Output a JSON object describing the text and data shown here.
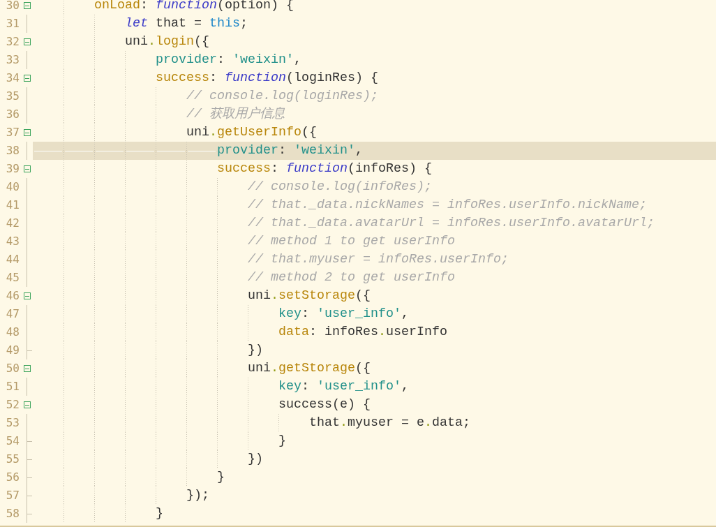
{
  "editor": {
    "lines": [
      {
        "number": "30",
        "kind": "code",
        "current": false,
        "tokens": [
          {
            "text": "onLoad",
            "kind": "method"
          },
          {
            "text": ": ",
            "kind": "plain"
          },
          {
            "text": "function",
            "kind": "keyword"
          },
          {
            "text": "(option) {",
            "kind": "plain"
          }
        ],
        "children": [
          {
            "number": "31",
            "kind": "code",
            "current": false,
            "tokens": [
              {
                "text": "let",
                "kind": "keyword"
              },
              {
                "text": " that = ",
                "kind": "plain"
              },
              {
                "text": "this",
                "kind": "this"
              },
              {
                "text": ";",
                "kind": "plain"
              }
            ]
          },
          {
            "number": "32",
            "kind": "code",
            "current": false,
            "tokens": [
              {
                "text": "uni",
                "kind": "plain"
              },
              {
                "text": ".",
                "kind": "dot"
              },
              {
                "text": "login",
                "kind": "method"
              },
              {
                "text": "({",
                "kind": "plain"
              }
            ],
            "children": [
              {
                "number": "33",
                "kind": "code",
                "current": false,
                "tokens": [
                  {
                    "text": "provider",
                    "kind": "prop"
                  },
                  {
                    "text": ": ",
                    "kind": "plain"
                  },
                  {
                    "text": "'weixin'",
                    "kind": "string"
                  },
                  {
                    "text": ",",
                    "kind": "plain"
                  }
                ]
              },
              {
                "number": "34",
                "kind": "code",
                "current": false,
                "tokens": [
                  {
                    "text": "success",
                    "kind": "method"
                  },
                  {
                    "text": ": ",
                    "kind": "plain"
                  },
                  {
                    "text": "function",
                    "kind": "keyword"
                  },
                  {
                    "text": "(loginRes) {",
                    "kind": "plain"
                  }
                ],
                "children": [
                  {
                    "number": "35",
                    "kind": "code",
                    "current": false,
                    "tokens": [
                      {
                        "text": "// console.log(loginRes);",
                        "kind": "comment"
                      }
                    ]
                  },
                  {
                    "number": "36",
                    "kind": "code",
                    "current": false,
                    "tokens": [
                      {
                        "text": "// 获取用户信息",
                        "kind": "comment"
                      }
                    ]
                  },
                  {
                    "number": "37",
                    "kind": "code",
                    "current": false,
                    "tokens": [
                      {
                        "text": "uni",
                        "kind": "plain"
                      },
                      {
                        "text": ".",
                        "kind": "dot"
                      },
                      {
                        "text": "getUserInfo",
                        "kind": "method"
                      },
                      {
                        "text": "({",
                        "kind": "plain"
                      }
                    ],
                    "children": [
                      {
                        "number": "38",
                        "kind": "code",
                        "current": true,
                        "tokens": [
                          {
                            "text": "provider",
                            "kind": "prop"
                          },
                          {
                            "text": ": ",
                            "kind": "plain"
                          },
                          {
                            "text": "'weixin'",
                            "kind": "string"
                          },
                          {
                            "text": ",",
                            "kind": "plain"
                          }
                        ]
                      },
                      {
                        "number": "39",
                        "kind": "code",
                        "current": false,
                        "tokens": [
                          {
                            "text": "success",
                            "kind": "method"
                          },
                          {
                            "text": ": ",
                            "kind": "plain"
                          },
                          {
                            "text": "function",
                            "kind": "keyword"
                          },
                          {
                            "text": "(infoRes) {",
                            "kind": "plain"
                          }
                        ],
                        "children": [
                          {
                            "number": "40",
                            "kind": "code",
                            "current": false,
                            "tokens": [
                              {
                                "text": "// console.log(infoRes);",
                                "kind": "comment"
                              }
                            ]
                          },
                          {
                            "number": "41",
                            "kind": "code",
                            "current": false,
                            "tokens": [
                              {
                                "text": "// that._data.nickNames = infoRes.userInfo.nickName;",
                                "kind": "comment"
                              }
                            ]
                          },
                          {
                            "number": "42",
                            "kind": "code",
                            "current": false,
                            "tokens": [
                              {
                                "text": "// that._data.avatarUrl = infoRes.userInfo.avatarUrl;",
                                "kind": "comment"
                              }
                            ]
                          },
                          {
                            "number": "43",
                            "kind": "code",
                            "current": false,
                            "tokens": [
                              {
                                "text": "// method 1 to get userInfo",
                                "kind": "comment"
                              }
                            ]
                          },
                          {
                            "number": "44",
                            "kind": "code",
                            "current": false,
                            "tokens": [
                              {
                                "text": "// that.myuser = infoRes.userInfo;",
                                "kind": "comment"
                              }
                            ]
                          },
                          {
                            "number": "45",
                            "kind": "code",
                            "current": false,
                            "tokens": [
                              {
                                "text": "// method 2 to get userInfo",
                                "kind": "comment"
                              }
                            ]
                          },
                          {
                            "number": "46",
                            "kind": "code",
                            "current": false,
                            "tokens": [
                              {
                                "text": "uni",
                                "kind": "plain"
                              },
                              {
                                "text": ".",
                                "kind": "dot"
                              },
                              {
                                "text": "setStorage",
                                "kind": "method"
                              },
                              {
                                "text": "({",
                                "kind": "plain"
                              }
                            ],
                            "children": [
                              {
                                "number": "47",
                                "kind": "code",
                                "current": false,
                                "tokens": [
                                  {
                                    "text": "key",
                                    "kind": "prop"
                                  },
                                  {
                                    "text": ": ",
                                    "kind": "plain"
                                  },
                                  {
                                    "text": "'user_info'",
                                    "kind": "string"
                                  },
                                  {
                                    "text": ",",
                                    "kind": "plain"
                                  }
                                ]
                              },
                              {
                                "number": "48",
                                "kind": "code",
                                "current": false,
                                "tokens": [
                                  {
                                    "text": "data",
                                    "kind": "method"
                                  },
                                  {
                                    "text": ": infoRes",
                                    "kind": "plain"
                                  },
                                  {
                                    "text": ".",
                                    "kind": "dot"
                                  },
                                  {
                                    "text": "userInfo",
                                    "kind": "plain"
                                  }
                                ]
                              }
                            ]
                          },
                          {
                            "number": "49",
                            "kind": "end",
                            "current": false,
                            "tokens": [
                              {
                                "text": "})",
                                "kind": "plain"
                              }
                            ]
                          },
                          {
                            "number": "50",
                            "kind": "code",
                            "current": false,
                            "tokens": [
                              {
                                "text": "uni",
                                "kind": "plain"
                              },
                              {
                                "text": ".",
                                "kind": "dot"
                              },
                              {
                                "text": "getStorage",
                                "kind": "method"
                              },
                              {
                                "text": "({",
                                "kind": "plain"
                              }
                            ],
                            "children": [
                              {
                                "number": "51",
                                "kind": "code",
                                "current": false,
                                "tokens": [
                                  {
                                    "text": "key",
                                    "kind": "prop"
                                  },
                                  {
                                    "text": ": ",
                                    "kind": "plain"
                                  },
                                  {
                                    "text": "'user_info'",
                                    "kind": "string"
                                  },
                                  {
                                    "text": ",",
                                    "kind": "plain"
                                  }
                                ]
                              },
                              {
                                "number": "52",
                                "kind": "code",
                                "current": false,
                                "tokens": [
                                  {
                                    "text": "success(e) {",
                                    "kind": "plain"
                                  }
                                ],
                                "children": [
                                  {
                                    "number": "53",
                                    "kind": "code",
                                    "current": false,
                                    "tokens": [
                                      {
                                        "text": "that",
                                        "kind": "plain"
                                      },
                                      {
                                        "text": ".",
                                        "kind": "dot"
                                      },
                                      {
                                        "text": "myuser = e",
                                        "kind": "plain"
                                      },
                                      {
                                        "text": ".",
                                        "kind": "dot"
                                      },
                                      {
                                        "text": "data;",
                                        "kind": "plain"
                                      }
                                    ]
                                  }
                                ]
                              },
                              {
                                "number": "54",
                                "kind": "end",
                                "current": false,
                                "tokens": [
                                  {
                                    "text": "}",
                                    "kind": "plain"
                                  }
                                ]
                              }
                            ]
                          },
                          {
                            "number": "55",
                            "kind": "end",
                            "current": false,
                            "tokens": [
                              {
                                "text": "})",
                                "kind": "plain"
                              }
                            ]
                          }
                        ]
                      },
                      {
                        "number": "56",
                        "kind": "end",
                        "current": false,
                        "tokens": [
                          {
                            "text": "}",
                            "kind": "plain"
                          }
                        ]
                      }
                    ]
                  },
                  {
                    "number": "57",
                    "kind": "end",
                    "current": false,
                    "tokens": [
                      {
                        "text": "});",
                        "kind": "plain"
                      }
                    ]
                  }
                ]
              },
              {
                "number": "58",
                "kind": "end",
                "current": false,
                "tokens": [
                  {
                    "text": "}",
                    "kind": "plain"
                  }
                ]
              }
            ]
          }
        ]
      }
    ]
  }
}
